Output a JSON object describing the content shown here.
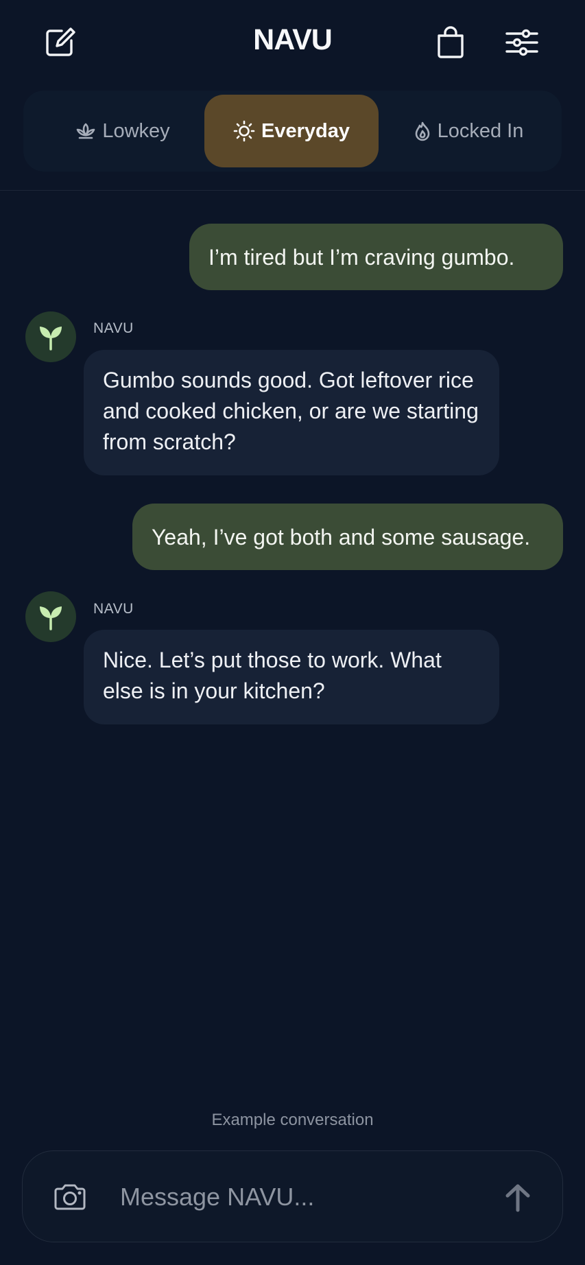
{
  "header": {
    "title": "NAVU",
    "compose_icon": "compose-icon",
    "bag_icon": "shopping-bag-icon",
    "settings_icon": "sliders-icon"
  },
  "modes": {
    "items": [
      {
        "label": "Lowkey",
        "icon": "lotus-icon",
        "active": false
      },
      {
        "label": "Everyday",
        "icon": "sun-icon",
        "active": true
      },
      {
        "label": "Locked In",
        "icon": "flame-icon",
        "active": false
      }
    ],
    "active_color": "#5b4829"
  },
  "messages": [
    {
      "role": "user",
      "text": "I’m tired but I’m craving gumbo."
    },
    {
      "role": "assistant",
      "sender": "NAVU",
      "avatar_icon": "sprout-icon",
      "text": "Gumbo sounds good. Got leftover rice and cooked chicken, or are we starting from scratch?"
    },
    {
      "role": "user",
      "text": "Yeah, I’ve got both and some sausage."
    },
    {
      "role": "assistant",
      "sender": "NAVU",
      "avatar_icon": "sprout-icon",
      "text": "Nice. Let’s put those to work. What else is in your kitchen?"
    }
  ],
  "caption": "Example conversation",
  "composer": {
    "placeholder": "Message NAVU...",
    "value": "",
    "camera_icon": "camera-icon",
    "send_icon": "arrow-up-icon"
  },
  "colors": {
    "background": "#0c1527",
    "user_bubble": "#3b4c36",
    "assistant_bubble": "#172236",
    "avatar_bg": "#243a2c",
    "sprout": "#c7ecb0"
  }
}
